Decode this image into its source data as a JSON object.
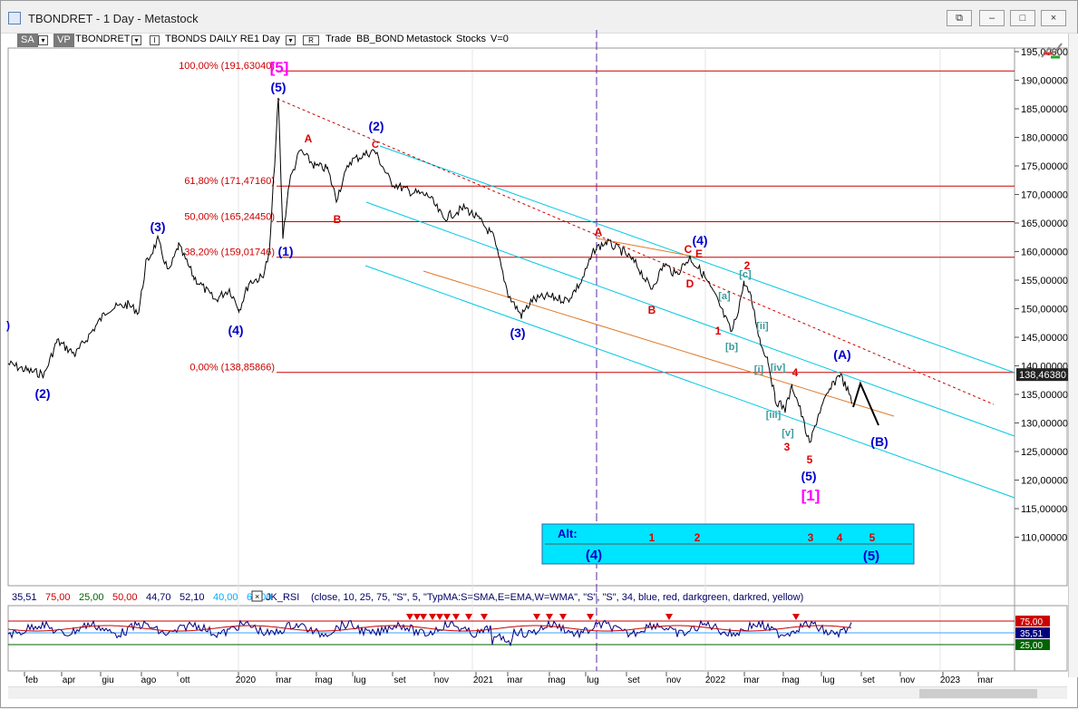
{
  "window": {
    "title": "TBONDRET - 1 Day - Metastock",
    "controls": {
      "restore_all": "⧉",
      "minimize": "–",
      "maximize": "□",
      "close": "×"
    }
  },
  "toolbar": {
    "sa": "SA",
    "vp": "VP",
    "symbol": "TBONDRET",
    "series": "TBONDS DAILY RE",
    "period": "1 Day",
    "mode_r": "R",
    "trade": "Trade",
    "source": "BB_BOND",
    "vendor": "Metastock",
    "type": "Stocks",
    "volume": "V=0"
  },
  "colors": {
    "price": "#000000",
    "fib": "#cc0000",
    "channel": "#00c8e0",
    "midline": "#e07a2a",
    "wave_major": "#0000cc",
    "wave_minor": "#dd0000",
    "wave_sub": "#3a9a9a",
    "cycle": "#ff00ff",
    "alt_box": "#00e5ff"
  },
  "price_axis": {
    "ticks": [
      "195,00000",
      "190,00000",
      "185,00000",
      "180,00000",
      "175,00000",
      "170,00000",
      "165,00000",
      "160,00000",
      "155,00000",
      "150,00000",
      "145,00000",
      "140,00000",
      "135,00000",
      "130,00000",
      "125,00000",
      "120,00000",
      "115,00000",
      "110,00000"
    ],
    "last_price": "138,46380"
  },
  "fib_levels": [
    {
      "label": "100,00% (191,63040)",
      "value": 191.6304
    },
    {
      "label": "61,80% (171,47160)",
      "value": 171.4716
    },
    {
      "label": "50,00% (165,24450)",
      "value": 165.2445
    },
    {
      "label": "38,20% (159,01746)",
      "value": 159.01746
    },
    {
      "label": "0,00% (138,85866)",
      "value": 138.85866
    }
  ],
  "time_axis": [
    "feb",
    "apr",
    "giu",
    "ago",
    "ott",
    "2020",
    "mar",
    "mag",
    "lug",
    "set",
    "nov",
    "2021",
    "mar",
    "mag",
    "lug",
    "set",
    "nov",
    "2022",
    "mar",
    "mag",
    "lug",
    "set",
    "nov",
    "2023",
    "mar"
  ],
  "wave_labels": [
    {
      "t": ")",
      "c": "wave_major"
    },
    {
      "t": "(2)",
      "c": "wave_major"
    },
    {
      "t": "(3)",
      "c": "wave_major"
    },
    {
      "t": "(4)",
      "c": "wave_major"
    },
    {
      "t": "[5]",
      "c": "cycle"
    },
    {
      "t": "(5)",
      "c": "wave_major"
    },
    {
      "t": "(1)",
      "c": "wave_major"
    },
    {
      "t": "A",
      "c": "wave_minor"
    },
    {
      "t": "B",
      "c": "wave_minor"
    },
    {
      "t": "(2)",
      "c": "wave_major"
    },
    {
      "t": "C",
      "c": "wave_minor"
    },
    {
      "t": "(3)",
      "c": "wave_major"
    },
    {
      "t": "A",
      "c": "wave_minor"
    },
    {
      "t": "B",
      "c": "wave_minor"
    },
    {
      "t": "C",
      "c": "wave_minor"
    },
    {
      "t": "E",
      "c": "wave_minor"
    },
    {
      "t": "D",
      "c": "wave_minor"
    },
    {
      "t": "(4)",
      "c": "wave_major"
    },
    {
      "t": "2",
      "c": "wave_minor"
    },
    {
      "t": "[c]",
      "c": "wave_sub"
    },
    {
      "t": "[a]",
      "c": "wave_sub"
    },
    {
      "t": "[b]",
      "c": "wave_sub"
    },
    {
      "t": "1",
      "c": "wave_minor"
    },
    {
      "t": "[ii]",
      "c": "wave_sub"
    },
    {
      "t": "[i]",
      "c": "wave_sub"
    },
    {
      "t": "[iv]",
      "c": "wave_sub"
    },
    {
      "t": "[iii]",
      "c": "wave_sub"
    },
    {
      "t": "[v]",
      "c": "wave_sub"
    },
    {
      "t": "3",
      "c": "wave_minor"
    },
    {
      "t": "4",
      "c": "wave_minor"
    },
    {
      "t": "5",
      "c": "wave_minor"
    },
    {
      "t": "(5)",
      "c": "wave_major"
    },
    {
      "t": "[1]",
      "c": "cycle"
    },
    {
      "t": "(A)",
      "c": "wave_major"
    },
    {
      "t": "(B)",
      "c": "wave_major"
    }
  ],
  "alt_box": {
    "title": "Alt:",
    "minor": [
      "1",
      "2",
      "3",
      "4",
      "5"
    ],
    "major_left": "(4)",
    "major_right": "(5)"
  },
  "indicator": {
    "values_line": [
      "35,51",
      "75,00",
      "25,00",
      "50,00",
      "44,70",
      "52,10",
      "40,00",
      "60,00"
    ],
    "name": "JK_RSI",
    "params": "(close,  10,  25,  75,  \"S\",  5,  \"TypMA:S=SMA,E=EMA,W=WMA\",  \"S\",  \"S\",  34,  blue,  red,  darkgreen,  darkred,  yellow)",
    "levels": [
      "75,00",
      "35,51",
      "25,00"
    ]
  }
}
